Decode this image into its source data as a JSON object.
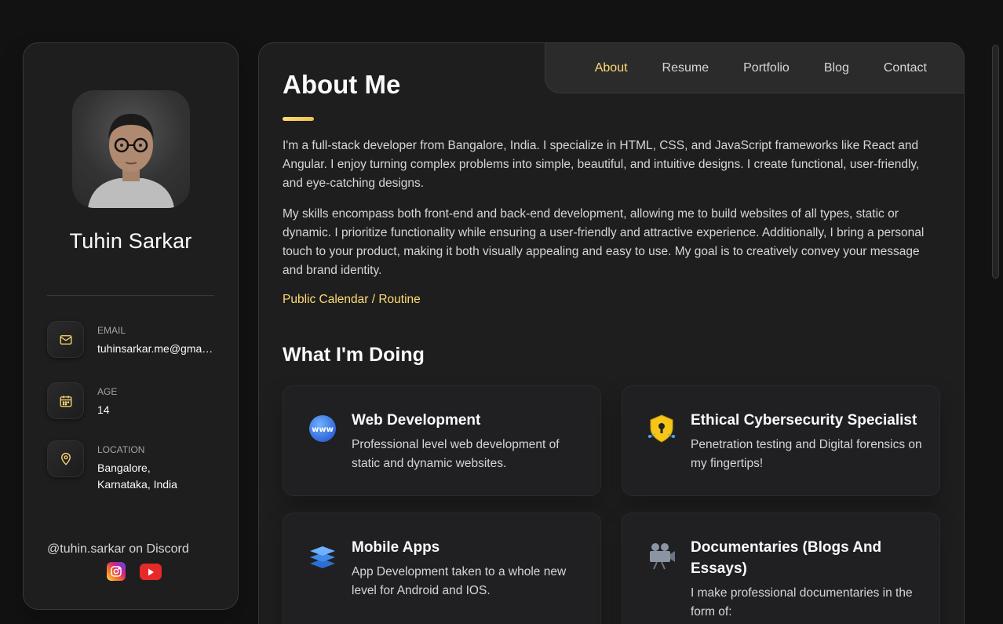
{
  "profile": {
    "name": "Tuhin Sarkar",
    "contacts": [
      {
        "title": "Email",
        "value": "tuhinsarkar.me@gmail.com",
        "icon": "mail-icon"
      },
      {
        "title": "Age",
        "value": "14",
        "icon": "calendar-icon"
      },
      {
        "title": "Location",
        "value": "Bangalore, Karnataka, India",
        "icon": "location-pin-icon"
      }
    ],
    "discord": "@tuhin.sarkar on Discord",
    "socials": [
      "instagram-icon",
      "youtube-icon"
    ]
  },
  "nav": {
    "items": [
      "About",
      "Resume",
      "Portfolio",
      "Blog",
      "Contact"
    ],
    "active": "About"
  },
  "about": {
    "title": "About Me",
    "paragraphs": [
      "I'm a full-stack developer from Bangalore, India. I specialize in HTML, CSS, and JavaScript frameworks like React and Angular. I enjoy turning complex problems into simple, beautiful, and intuitive designs. I create functional, user-friendly, and eye-catching designs.",
      "My skills encompass both front-end and back-end development, allowing me to build websites of all types, static or dynamic. I prioritize functionality while ensuring a user-friendly and attractive experience. Additionally, I bring a personal touch to your product, making it both visually appealing and easy to use. My goal is to creatively convey your message and brand identity."
    ],
    "calendar_link": "Public Calendar / Routine"
  },
  "services": {
    "title": "What I'm Doing",
    "items": [
      {
        "title": "Web Development",
        "text": "Professional level web development of static and dynamic websites.",
        "icon": "www-globe-icon"
      },
      {
        "title": "Ethical Cybersecurity Specialist",
        "text": "Penetration testing and Digital forensics on my fingertips!",
        "icon": "shield-lock-icon"
      },
      {
        "title": "Mobile Apps",
        "text": "App Development taken to a whole new level for Android and IOS.",
        "icon": "layers-icon"
      },
      {
        "title": "Documentaries (Blogs And Essays)",
        "text": "I make professional documentaries in the form of:",
        "icon": "video-camera-icon"
      }
    ]
  },
  "colors": {
    "accent": "#ffdb70",
    "background": "#121212",
    "panel": "#1e1e1f"
  }
}
